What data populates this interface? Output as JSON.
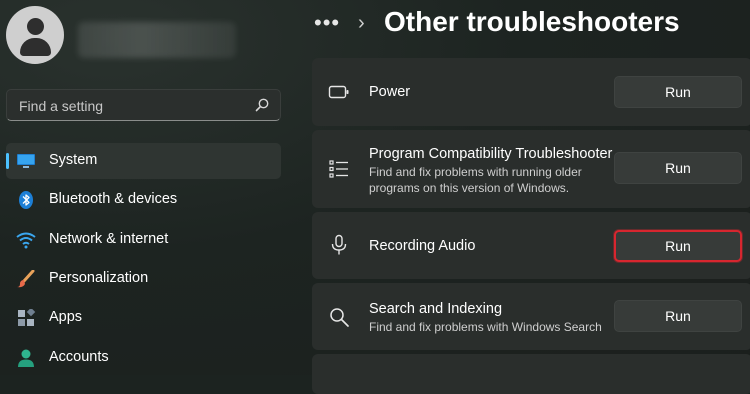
{
  "sidebar": {
    "search": {
      "placeholder": "Find a setting"
    },
    "items": [
      {
        "label": "System",
        "icon": "monitor-icon",
        "selected": true
      },
      {
        "label": "Bluetooth & devices",
        "icon": "bluetooth-icon"
      },
      {
        "label": "Network & internet",
        "icon": "wifi-icon"
      },
      {
        "label": "Personalization",
        "icon": "brush-icon"
      },
      {
        "label": "Apps",
        "icon": "apps-icon"
      },
      {
        "label": "Accounts",
        "icon": "person-icon"
      }
    ]
  },
  "header": {
    "more": "•••",
    "separator": "›",
    "title": "Other troubleshooters"
  },
  "troubleshooters": [
    {
      "title": "Power",
      "description": "",
      "icon": "battery-icon",
      "button": "Run"
    },
    {
      "title": "Program Compatibility Troubleshooter",
      "description": "Find and fix problems with running older programs on this version of Windows.",
      "icon": "list-icon",
      "button": "Run"
    },
    {
      "title": "Recording Audio",
      "description": "",
      "icon": "microphone-icon",
      "button": "Run",
      "highlighted": true
    },
    {
      "title": "Search and Indexing",
      "description": "Find and fix problems with Windows Search",
      "icon": "search-icon",
      "button": "Run"
    }
  ],
  "colors": {
    "accent": "#4cc2ff",
    "highlight": "#d7262f",
    "card": "#2a2e2c"
  }
}
